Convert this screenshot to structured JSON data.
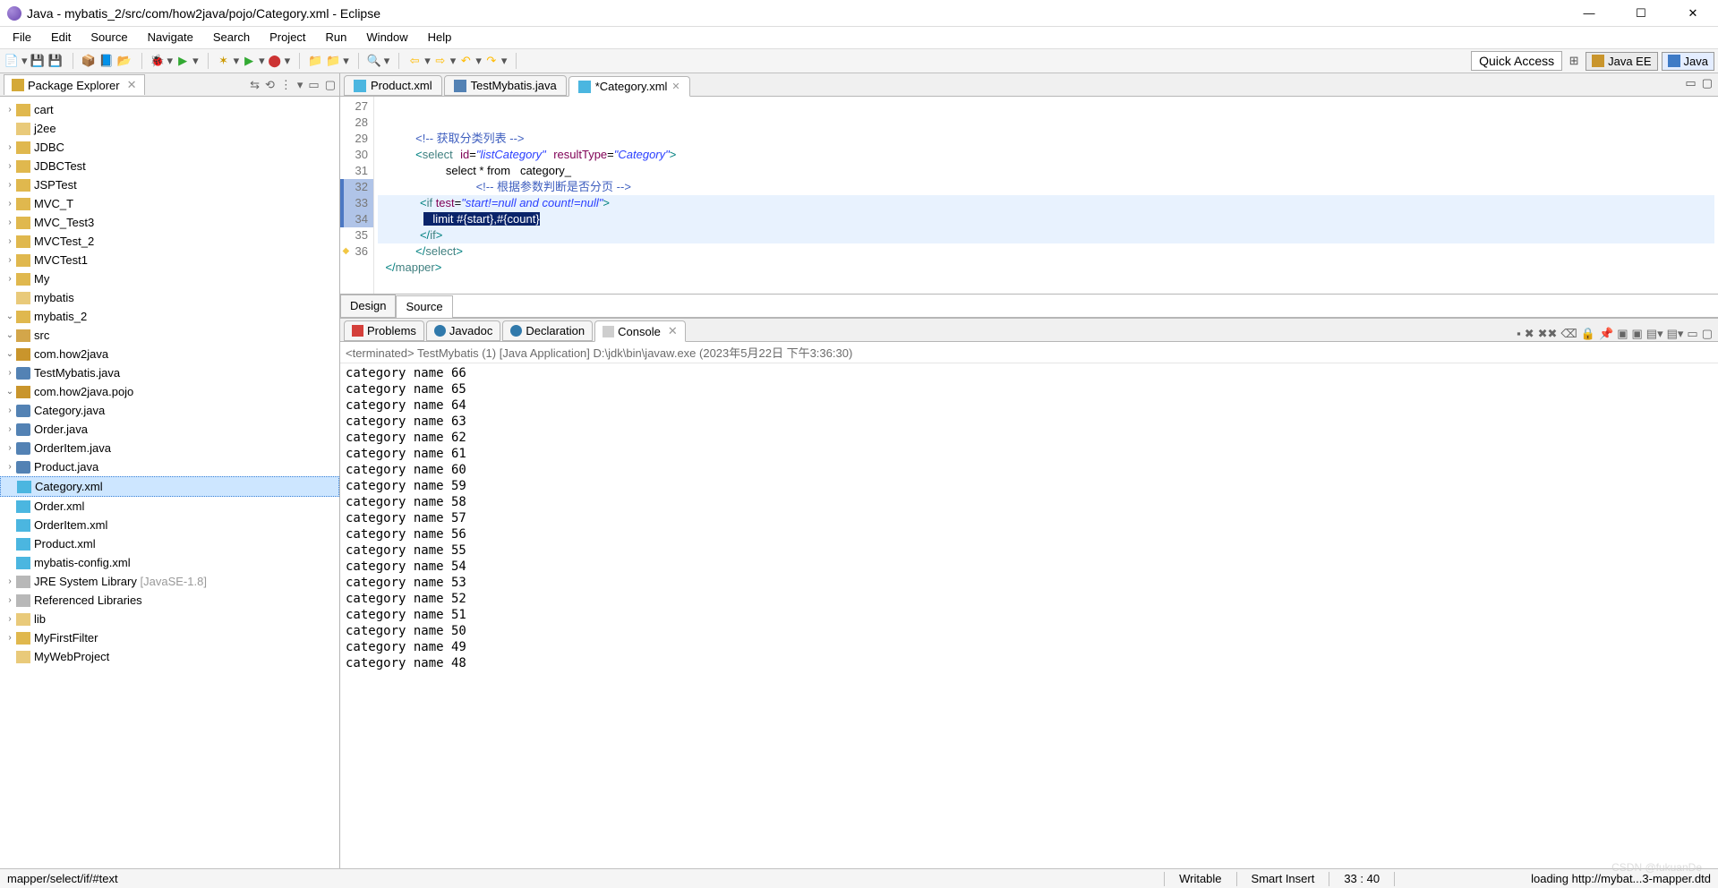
{
  "window": {
    "title": "Java - mybatis_2/src/com/how2java/pojo/Category.xml - Eclipse"
  },
  "menu": [
    "File",
    "Edit",
    "Source",
    "Navigate",
    "Search",
    "Project",
    "Run",
    "Window",
    "Help"
  ],
  "quick_access": "Quick Access",
  "perspectives": {
    "java_ee": "Java EE",
    "java": "Java"
  },
  "package_explorer": {
    "title": "Package Explorer",
    "projects_closed": [
      "cart",
      "j2ee",
      "JDBC",
      "JDBCTest",
      "JSPTest",
      "MVC_T",
      "MVC_Test3",
      "MVCTest_2",
      "MVCTest1",
      "My",
      "mybatis"
    ],
    "open_project": "mybatis_2",
    "src": "src",
    "packages": {
      "p1": "com.how2java",
      "p1_files": [
        "TestMybatis.java"
      ],
      "p2": "com.how2java.pojo",
      "p2_files": [
        "Category.java",
        "Order.java",
        "OrderItem.java",
        "Product.java",
        "Category.xml",
        "Order.xml",
        "OrderItem.xml",
        "Product.xml"
      ],
      "p3_file": "mybatis-config.xml"
    },
    "jre": "JRE System Library",
    "jre_ver": "[JavaSE-1.8]",
    "refs": "Referenced Libraries",
    "lib": "lib",
    "projects_after": [
      "MyFirstFilter",
      "MyWebProject"
    ]
  },
  "editor": {
    "tabs": [
      {
        "label": "Product.xml",
        "active": false
      },
      {
        "label": "TestMybatis.java",
        "active": false
      },
      {
        "label": "*Category.xml",
        "active": true
      }
    ],
    "lines_start": 27,
    "warn_line": 36,
    "design_tabs": [
      "Design",
      "Source"
    ],
    "design_active": "Source",
    "code": {
      "l27": "",
      "l28_comment": "<!-- 获取分类列表 -->",
      "l29_open": "<select",
      "l29_idattr": "id=",
      "l29_idval": "\"listCategory\"",
      "l29_rtattr": "resultType=",
      "l29_rtval": "\"Category\"",
      "l30_text": "select * from   category_",
      "l31_comment": "<!-- 根据参数判断是否分页 -->",
      "l32_if_open": "<if",
      "l32_testattr": "test=",
      "l32_testval": "\"start!=null and count!=null\"",
      "l33_selected": "   limit #{start},#{count}",
      "l34_if_close": "</if>",
      "l35_select_close": "</select>",
      "l36_mapper_close": "</mapper>"
    }
  },
  "bottom": {
    "tabs": [
      "Problems",
      "Javadoc",
      "Declaration",
      "Console"
    ],
    "active": "Console",
    "console_title": "<terminated> TestMybatis (1) [Java Application] D:\\jdk\\bin\\javaw.exe (2023年5月22日 下午3:36:30)",
    "output": [
      "category name 66",
      "category name 65",
      "category name 64",
      "category name 63",
      "category name 62",
      "category name 61",
      "category name 60",
      "category name 59",
      "category name 58",
      "category name 57",
      "category name 56",
      "category name 55",
      "category name 54",
      "category name 53",
      "category name 52",
      "category name 51",
      "category name 50",
      "category name 49",
      "category name 48"
    ]
  },
  "status": {
    "path": "mapper/select/if/#text",
    "writable": "Writable",
    "insert": "Smart Insert",
    "pos": "33 : 40",
    "loading": "loading http://mybat...3-mapper.dtd"
  },
  "watermark": "CSDN @fukuanDe"
}
